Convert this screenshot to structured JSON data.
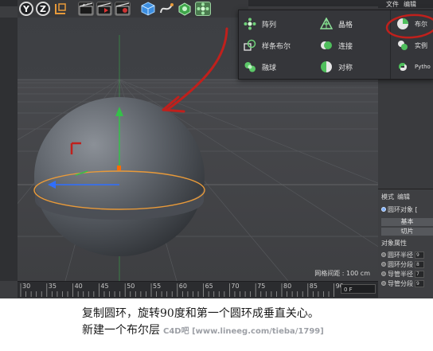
{
  "toolbar": {
    "buttons": [
      {
        "name": "y-axis-lock-button",
        "label": "Y"
      },
      {
        "name": "z-axis-lock-button",
        "label": "Z"
      }
    ]
  },
  "file_menu": {
    "items": [
      "文件",
      "编辑"
    ]
  },
  "popup": {
    "column1": [
      "阵列",
      "样条布尔",
      "融球"
    ],
    "column2": [
      "晶格",
      "连接",
      "对称"
    ],
    "column3": [
      "布尔",
      "实例",
      "Pytho"
    ]
  },
  "viewport": {
    "grid_label": "网格间距 : 100 cm"
  },
  "timeline": {
    "ticks": [
      "30",
      "35",
      "40",
      "45",
      "50",
      "55",
      "60",
      "65",
      "70",
      "75",
      "80",
      "85",
      "90"
    ],
    "frame_field": "0 F"
  },
  "attributes": {
    "tabs": [
      "模式",
      "编辑"
    ],
    "object_label": "圆环对象 [",
    "buttons": [
      "基本",
      "切片"
    ],
    "section_title": "对象属性",
    "fields": [
      {
        "label": "圆环半径",
        "value": "9"
      },
      {
        "label": "圆环分段",
        "value": "8"
      },
      {
        "label": "导管半径",
        "value": "7"
      },
      {
        "label": "导管分段",
        "value": "9"
      }
    ]
  },
  "caption": {
    "line1": "复制圆环，旋转90度和第一个圆环成垂直关心。",
    "line2": "新建一个布尔层",
    "watermark": "C4D吧 [www.lineeg.com/tieba/1799]"
  },
  "colors": {
    "annotation": "#c0201c",
    "accent_orange": "#e89a3a",
    "axis_green": "#35c049",
    "axis_blue": "#2f6fff"
  }
}
